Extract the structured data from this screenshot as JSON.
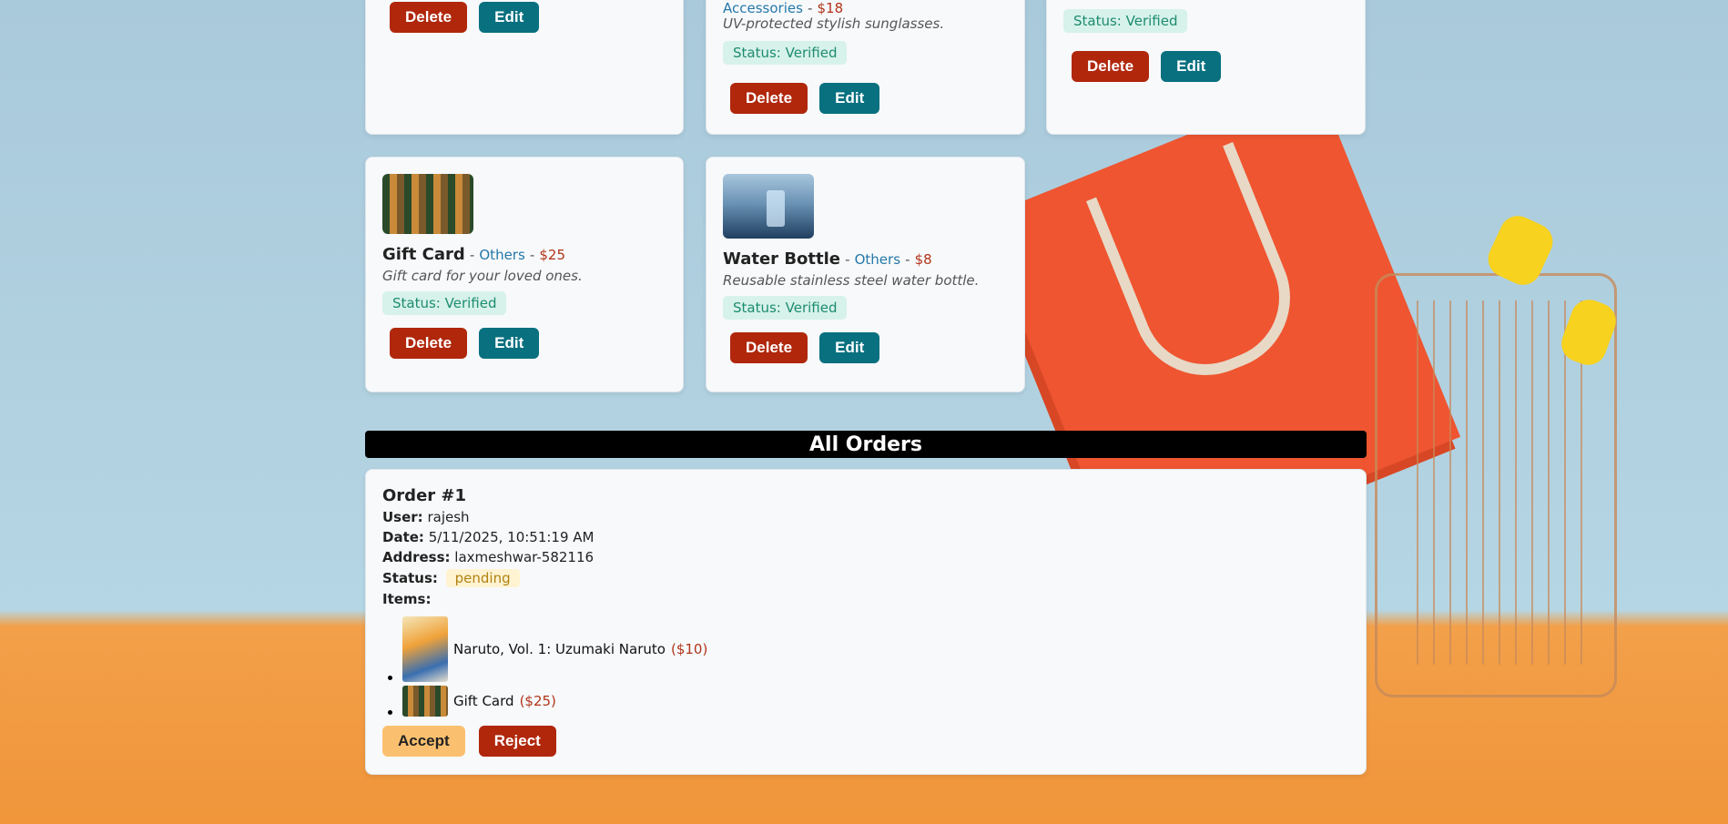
{
  "products": [
    {
      "delete_label": "Delete",
      "edit_label": "Edit"
    },
    {
      "category": "Accessories",
      "price": "$18",
      "description": "UV-protected stylish sunglasses.",
      "status": "Status: Verified",
      "delete_label": "Delete",
      "edit_label": "Edit"
    },
    {
      "status": "Status: Verified",
      "delete_label": "Delete",
      "edit_label": "Edit"
    },
    {
      "name": "Gift Card",
      "category": "Others",
      "price": "$25",
      "description": "Gift card for your loved ones.",
      "status": "Status: Verified",
      "delete_label": "Delete",
      "edit_label": "Edit"
    },
    {
      "name": "Water Bottle",
      "category": "Others",
      "price": "$8",
      "description": "Reusable stainless steel water bottle.",
      "status": "Status: Verified",
      "delete_label": "Delete",
      "edit_label": "Edit"
    }
  ],
  "separator": "-",
  "orders_title": "All Orders",
  "order": {
    "title": "Order #1",
    "user_label": "User:",
    "user": "rajesh",
    "date_label": "Date:",
    "date": "5/11/2025, 10:51:19 AM",
    "address_label": "Address:",
    "address": "laxmeshwar-582116",
    "status_label": "Status:",
    "status": "pending",
    "items_label": "Items:",
    "items": [
      {
        "name": "Naruto, Vol. 1: Uzumaki Naruto",
        "price": "($10)"
      },
      {
        "name": "Gift Card",
        "price": "($25)"
      }
    ],
    "accept_label": "Accept",
    "reject_label": "Reject"
  }
}
